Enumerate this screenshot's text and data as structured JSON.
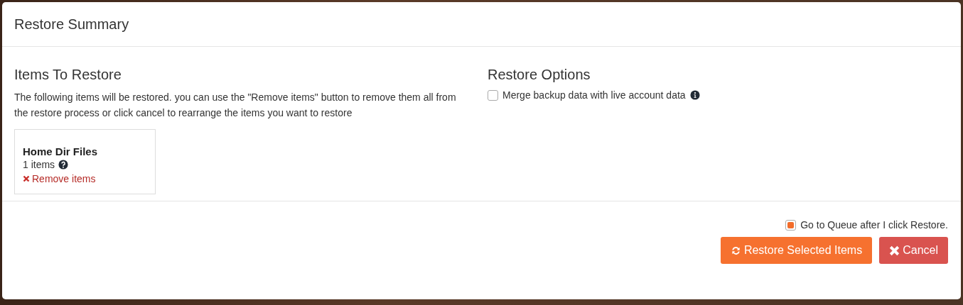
{
  "dialog": {
    "title": "Restore Summary"
  },
  "items_section": {
    "heading": "Items To Restore",
    "description": "The following items will be restored. you can use the \"Remove items\" button to remove them all from the restore process or click cancel to rearrange the items you want to restore",
    "cards": [
      {
        "name": "Home Dir Files",
        "count": "1 items",
        "remove_label": "Remove items"
      }
    ]
  },
  "options_section": {
    "heading": "Restore Options",
    "options": [
      {
        "label": "Merge backup data with live account data",
        "checked": false
      }
    ]
  },
  "footer": {
    "queue_option": {
      "label": "Go to Queue after I click Restore.",
      "checked": true
    },
    "buttons": [
      {
        "kind": "primary",
        "label": "Restore Selected Items"
      },
      {
        "kind": "danger",
        "label": "Cancel"
      }
    ]
  }
}
